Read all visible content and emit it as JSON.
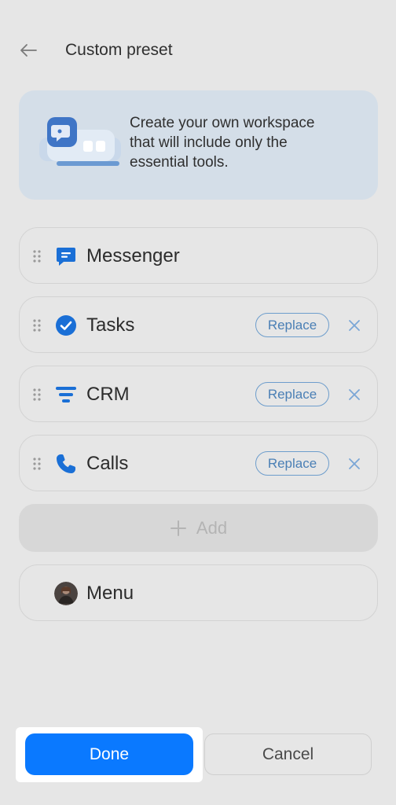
{
  "header": {
    "title": "Custom preset",
    "back_icon": "arrow-left-icon"
  },
  "banner": {
    "line1": "Create your own workspace",
    "line2": "that will include only the",
    "line3": "essential tools."
  },
  "tools": [
    {
      "label": "Messenger",
      "icon": "messenger-icon",
      "replace_label": "",
      "removable": false
    },
    {
      "label": "Tasks",
      "icon": "tasks-check-icon",
      "replace_label": "Replace",
      "removable": true
    },
    {
      "label": "CRM",
      "icon": "crm-filter-icon",
      "replace_label": "Replace",
      "removable": true
    },
    {
      "label": "Calls",
      "icon": "phone-icon",
      "replace_label": "Replace",
      "removable": true
    }
  ],
  "add": {
    "label": "Add"
  },
  "menu": {
    "label": "Menu"
  },
  "footer": {
    "done_label": "Done",
    "cancel_label": "Cancel"
  },
  "colors": {
    "accent": "#0a79ff",
    "icon_blue": "#1a6fd6",
    "background": "#e6e6e6"
  }
}
